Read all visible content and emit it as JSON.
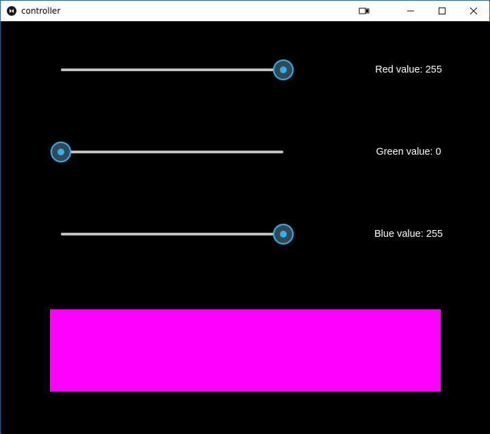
{
  "window": {
    "title": "controller",
    "controls": {
      "snap_icon": "snap-assist-icon",
      "minimize_icon": "minimize-icon",
      "maximize_icon": "maximize-icon",
      "close_icon": "close-icon"
    }
  },
  "sliders": [
    {
      "channel": "red",
      "value": 255,
      "max": 255,
      "label": "Red value: 255"
    },
    {
      "channel": "green",
      "value": 0,
      "max": 255,
      "label": "Green value: 0"
    },
    {
      "channel": "blue",
      "value": 255,
      "max": 255,
      "label": "Blue value: 255"
    }
  ],
  "preview": {
    "color": "#ff00ff"
  },
  "colors": {
    "accent": "#3aaee4",
    "track": "#bfbfbf",
    "background": "#000000"
  }
}
